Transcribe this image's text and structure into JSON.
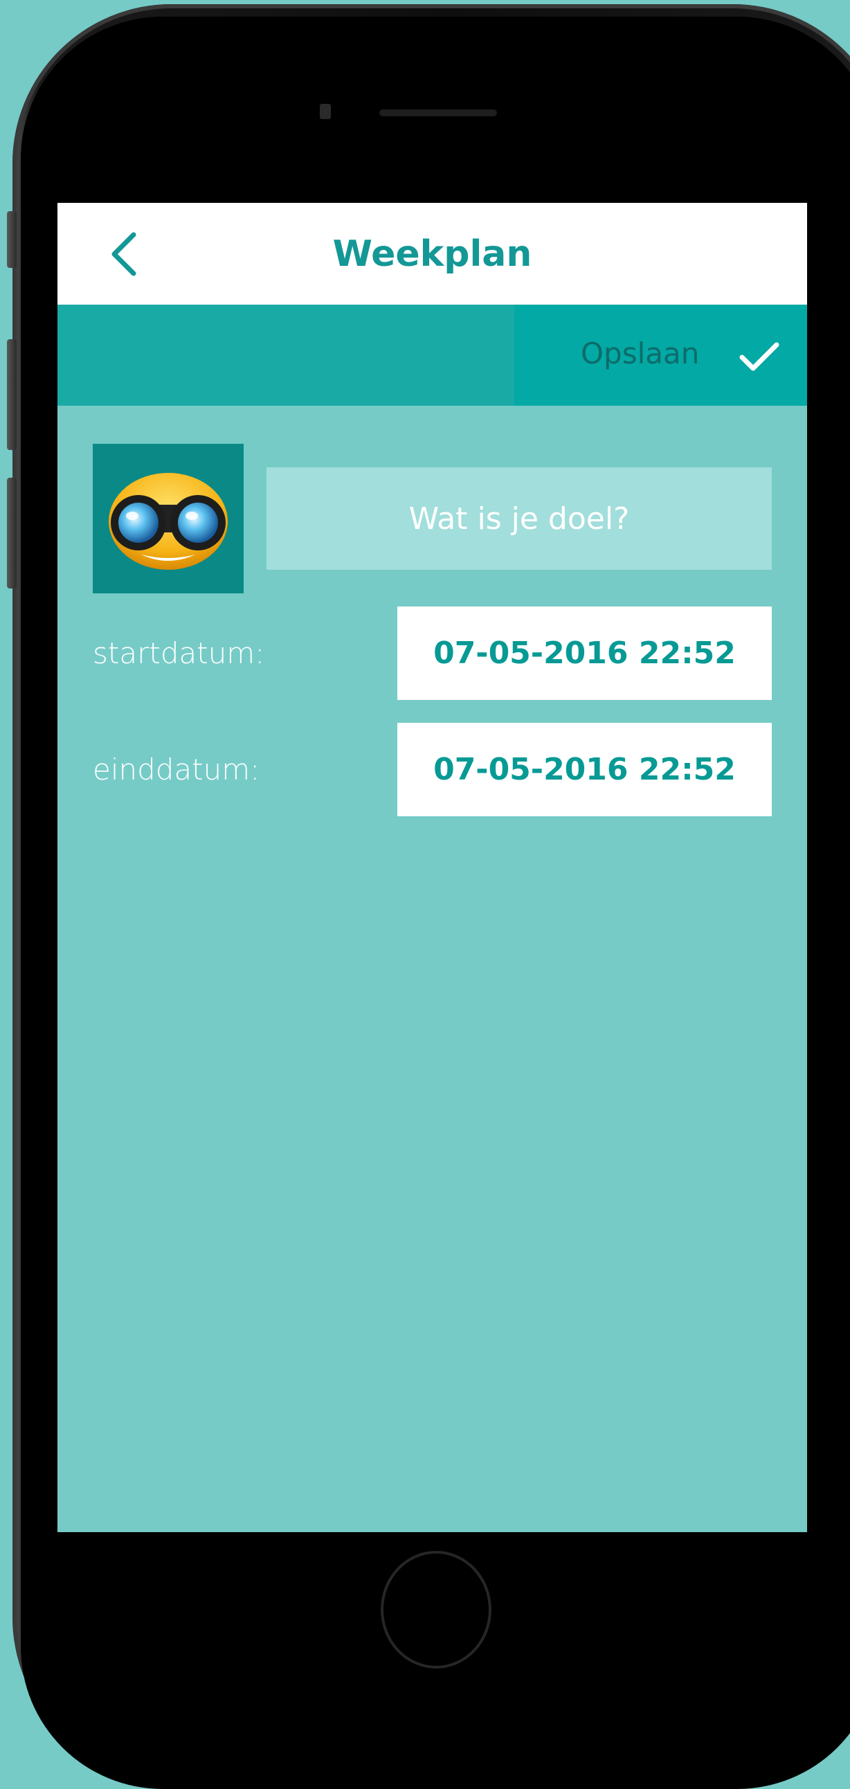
{
  "header": {
    "title": "Weekplan",
    "back_icon": "chevron-left-icon"
  },
  "toolbar": {
    "save_label": "Opslaan",
    "save_icon": "check-icon"
  },
  "goal": {
    "avatar_icon": "binoculars-icon",
    "placeholder": "Wat is je doel?",
    "value": ""
  },
  "dates": {
    "start_label": "startdatum:",
    "start_value": "07-05-2016 22:52",
    "end_label": "einddatum:",
    "end_value": "07-05-2016 22:52"
  },
  "colors": {
    "accent": "#139896",
    "toolbar": "#1aaaa6",
    "save_button": "#03a9a4",
    "background": "#76cbc7",
    "input": "#a2dedb",
    "date_text": "#079a95"
  }
}
